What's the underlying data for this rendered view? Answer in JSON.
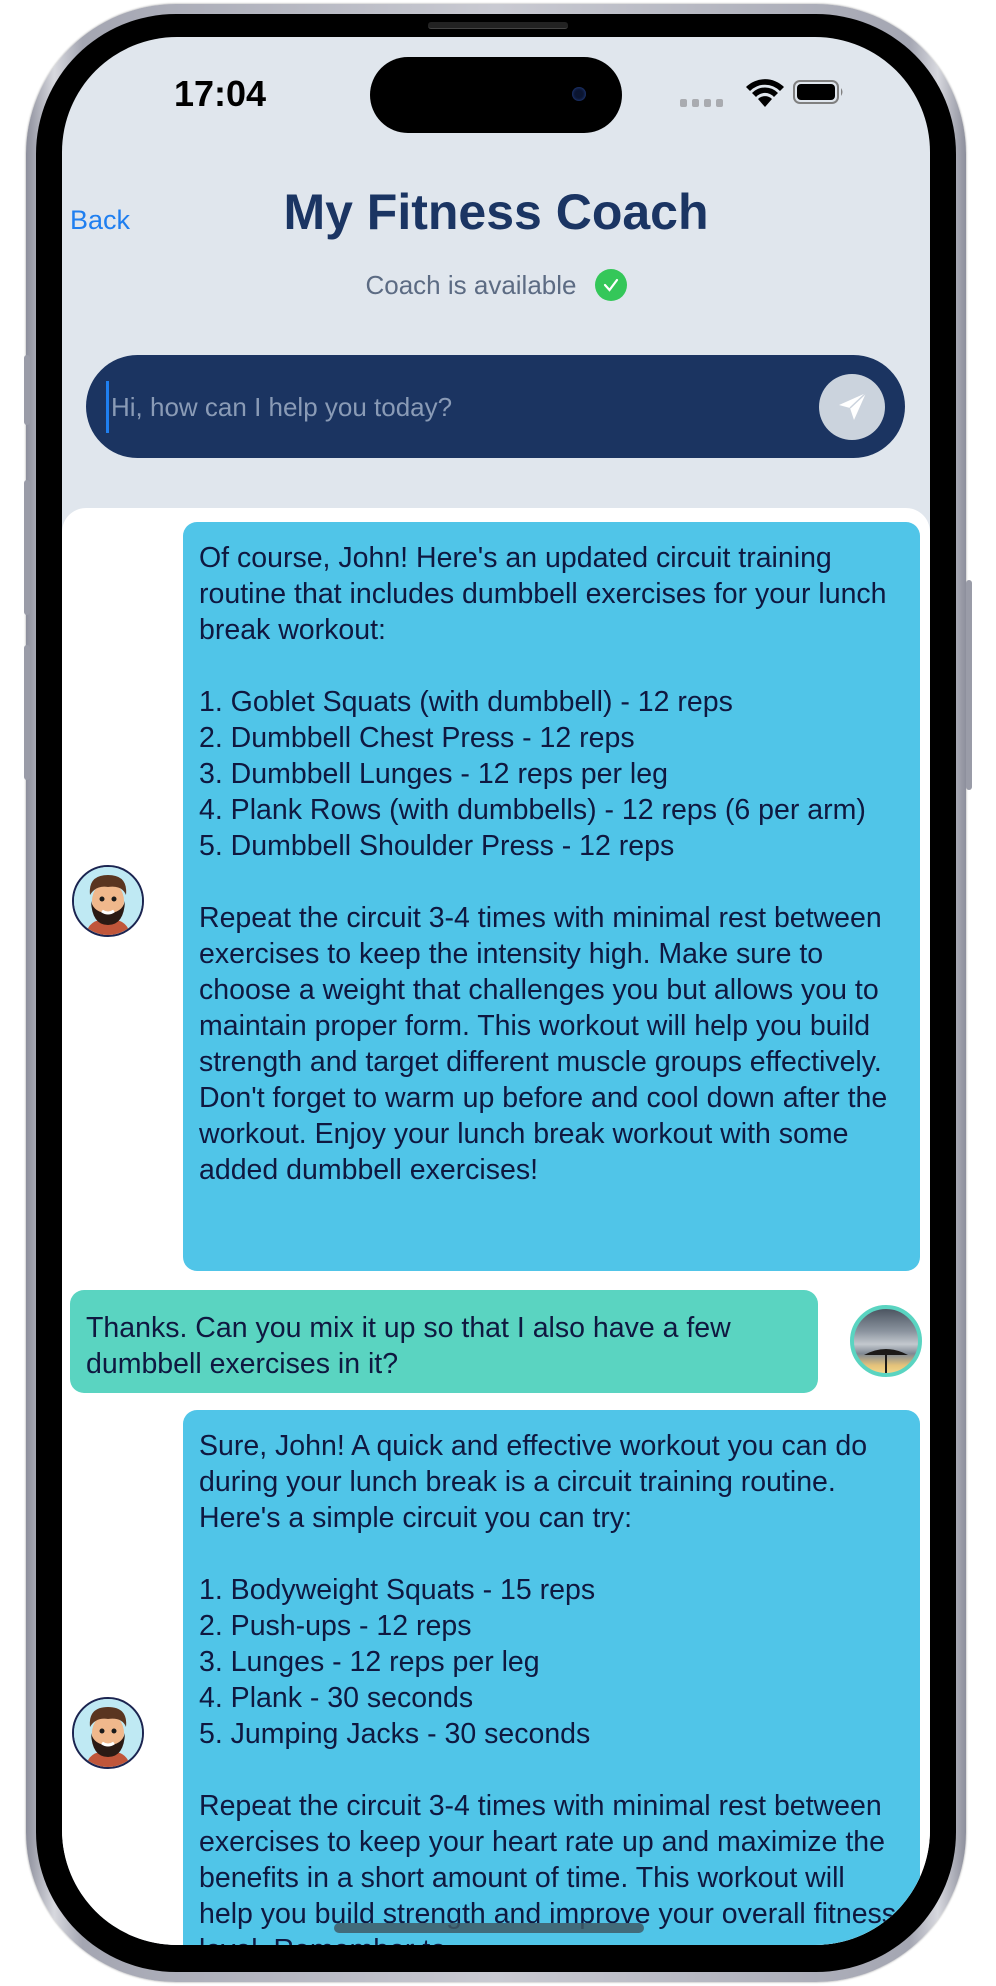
{
  "status_bar": {
    "time": "17:04",
    "signal_icon": "cellular-signal-icon",
    "wifi_icon": "wifi-icon",
    "battery_icon": "battery-icon"
  },
  "header": {
    "back_label": "Back",
    "title": "My Fitness Coach",
    "availability_text": "Coach is available",
    "availability_icon": "checkmark-circle-icon",
    "availability_color": "#34c759"
  },
  "composer": {
    "placeholder": "Hi, how can I help you today?",
    "value": "",
    "send_icon": "paper-plane-icon"
  },
  "colors": {
    "header_bg": "#e0e6ed",
    "title": "#1b3563",
    "composer_bg": "#1b3461",
    "bot_bubble": "#50c5e8",
    "user_bubble": "#5ad4c1",
    "link": "#1f7ff0"
  },
  "messages": [
    {
      "sender": "coach",
      "text": "Of course, John! Here's an updated circuit training routine that includes dumbbell exercises for your lunch break workout:\n\n1. Goblet Squats (with dumbbell) - 12 reps\n2. Dumbbell Chest Press - 12 reps\n3. Dumbbell Lunges - 12 reps per leg\n4. Plank Rows (with dumbbells) - 12 reps (6 per arm)\n5. Dumbbell Shoulder Press - 12 reps\n\nRepeat the circuit 3-4 times with minimal rest between exercises to keep the intensity high. Make sure to choose a weight that challenges you but allows you to maintain proper form. This workout will help you build strength and target different muscle groups effectively. Don't forget to warm up before and cool down after the workout. Enjoy your lunch break workout with some added dumbbell exercises!"
    },
    {
      "sender": "user",
      "text": "Thanks. Can you mix it up so that I also have a few dumbbell exercises in it?"
    },
    {
      "sender": "coach",
      "text": "Sure, John! A quick and effective workout you can do during your lunch break is a circuit training routine. Here's a simple circuit you can try:\n\n1. Bodyweight Squats - 15 reps\n2. Push-ups - 12 reps\n3. Lunges - 12 reps per leg\n4. Plank - 30 seconds\n5. Jumping Jacks - 30 seconds\n\nRepeat the circuit 3-4 times with minimal rest between exercises to keep your heart rate up and maximize the benefits in a short amount of time. This workout will help you build strength and improve your overall fitness level. Remember to"
    }
  ]
}
